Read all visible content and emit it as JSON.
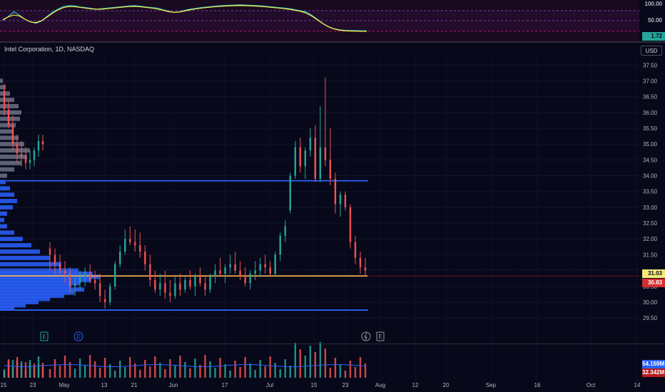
{
  "symbol": "Intel Corporation, 1D, NASDAQ",
  "currency": "USD",
  "stoch": {
    "levels": [
      "100.00",
      "50.00"
    ],
    "value_label": "1.72",
    "k_color": "#26c6da",
    "d_color": "#ffeb3b"
  },
  "price_axis": [
    "37.50",
    "37.00",
    "36.50",
    "36.00",
    "35.50",
    "35.00",
    "34.50",
    "34.00",
    "33.50",
    "33.00",
    "32.50",
    "32.00",
    "31.50",
    "30.50",
    "30.00",
    "29.50"
  ],
  "current_price": "31.03",
  "level_price": "30.83",
  "volume_labels": {
    "a": "54.159M",
    "b": "32.342M"
  },
  "time_axis": [
    "15",
    "23",
    "May",
    "13",
    "21",
    "Jun",
    "17",
    "Jul",
    "15",
    "23",
    "Aug",
    "12",
    "20",
    "Sep",
    "16",
    "Oct",
    "14"
  ],
  "events": {
    "earnings": "E",
    "dividend": "D",
    "split": "E"
  },
  "colors": {
    "up": "#26a69a",
    "down": "#ef5350",
    "bg": "#07081a",
    "hline": "#2962ff",
    "hline_gold": "#ffb74d",
    "profile": "#2962ff"
  },
  "chart_data": {
    "type": "candlestick",
    "x": [
      "Apr 11",
      "Apr 12",
      "Apr 15",
      "Apr 16",
      "Apr 17",
      "Apr 18",
      "Apr 19",
      "Apr 22",
      "Apr 23",
      "Apr 24",
      "Apr 25",
      "Apr 26",
      "Apr 29",
      "Apr 30",
      "May 1",
      "May 2",
      "May 3",
      "May 6",
      "May 7",
      "May 8",
      "May 9",
      "May 10",
      "May 13",
      "May 14",
      "May 15",
      "May 16",
      "May 17",
      "May 20",
      "May 21",
      "May 22",
      "May 23",
      "May 24",
      "May 28",
      "May 29",
      "May 30",
      "May 31",
      "Jun 3",
      "Jun 4",
      "Jun 5",
      "Jun 6",
      "Jun 7",
      "Jun 10",
      "Jun 11",
      "Jun 12",
      "Jun 13",
      "Jun 14",
      "Jun 17",
      "Jun 18",
      "Jun 20",
      "Jun 21",
      "Jun 24",
      "Jun 25",
      "Jun 26",
      "Jun 27",
      "Jun 28",
      "Jul 1",
      "Jul 2",
      "Jul 3",
      "Jul 5",
      "Jul 8",
      "Jul 9",
      "Jul 10",
      "Jul 11",
      "Jul 12",
      "Jul 15",
      "Jul 16",
      "Jul 17",
      "Jul 18",
      "Jul 19",
      "Jul 22",
      "Jul 23",
      "Jul 24",
      "Jul 25",
      "Jul 26"
    ],
    "ohlc": [
      [
        36.7,
        36.9,
        35.9,
        36.1
      ],
      [
        36.1,
        36.4,
        35.5,
        35.6
      ],
      [
        35.6,
        35.9,
        34.8,
        35.0
      ],
      [
        35.0,
        35.3,
        34.4,
        34.7
      ],
      [
        34.7,
        35.1,
        34.3,
        34.6
      ],
      [
        34.6,
        34.9,
        34.2,
        34.4
      ],
      [
        34.4,
        34.8,
        34.2,
        34.5
      ],
      [
        34.5,
        34.9,
        34.3,
        34.8
      ],
      [
        34.8,
        35.3,
        34.6,
        35.1
      ],
      [
        35.1,
        35.3,
        34.8,
        35.0
      ],
      [
        31.7,
        31.9,
        31.0,
        31.5
      ],
      [
        31.5,
        31.7,
        30.9,
        31.2
      ],
      [
        31.2,
        31.5,
        30.8,
        31.0
      ],
      [
        31.0,
        31.3,
        30.6,
        30.9
      ],
      [
        30.9,
        31.1,
        30.3,
        30.5
      ],
      [
        30.5,
        30.9,
        30.2,
        30.6
      ],
      [
        30.6,
        31.0,
        30.4,
        30.8
      ],
      [
        30.8,
        31.1,
        30.5,
        30.9
      ],
      [
        30.9,
        31.2,
        30.6,
        30.7
      ],
      [
        30.7,
        31.0,
        30.4,
        30.6
      ],
      [
        30.6,
        30.9,
        30.0,
        30.2
      ],
      [
        30.1,
        30.4,
        29.8,
        30.0
      ],
      [
        30.0,
        30.6,
        29.9,
        30.5
      ],
      [
        30.5,
        31.3,
        30.4,
        31.2
      ],
      [
        31.2,
        31.8,
        31.1,
        31.6
      ],
      [
        31.6,
        32.3,
        31.5,
        32.0
      ],
      [
        32.0,
        32.4,
        31.8,
        31.9
      ],
      [
        31.9,
        32.3,
        31.6,
        31.8
      ],
      [
        31.8,
        32.2,
        31.4,
        31.6
      ],
      [
        31.6,
        31.8,
        31.0,
        31.2
      ],
      [
        31.2,
        31.5,
        30.5,
        30.7
      ],
      [
        30.7,
        31.0,
        30.3,
        30.4
      ],
      [
        30.4,
        30.9,
        30.2,
        30.6
      ],
      [
        30.6,
        31.0,
        30.1,
        30.3
      ],
      [
        30.3,
        30.7,
        30.0,
        30.2
      ],
      [
        30.2,
        30.8,
        30.1,
        30.6
      ],
      [
        30.6,
        30.9,
        30.2,
        30.4
      ],
      [
        30.4,
        30.8,
        30.3,
        30.7
      ],
      [
        30.7,
        31.0,
        30.4,
        30.5
      ],
      [
        30.5,
        30.9,
        30.2,
        30.8
      ],
      [
        30.8,
        31.1,
        30.5,
        30.6
      ],
      [
        30.6,
        30.8,
        30.2,
        30.4
      ],
      [
        30.4,
        30.9,
        30.3,
        30.8
      ],
      [
        30.8,
        31.2,
        30.6,
        31.0
      ],
      [
        31.0,
        31.4,
        30.8,
        30.9
      ],
      [
        30.9,
        31.2,
        30.6,
        31.1
      ],
      [
        31.1,
        31.5,
        30.9,
        31.2
      ],
      [
        31.2,
        31.6,
        30.9,
        31.0
      ],
      [
        31.0,
        31.3,
        30.7,
        30.8
      ],
      [
        30.8,
        31.1,
        30.5,
        30.6
      ],
      [
        30.6,
        31.0,
        30.4,
        30.9
      ],
      [
        30.9,
        31.3,
        30.7,
        31.0
      ],
      [
        31.0,
        31.4,
        30.8,
        31.2
      ],
      [
        31.2,
        31.5,
        30.9,
        31.1
      ],
      [
        31.1,
        31.3,
        30.8,
        30.9
      ],
      [
        30.9,
        31.6,
        30.8,
        31.5
      ],
      [
        31.5,
        32.2,
        31.3,
        32.1
      ],
      [
        32.1,
        32.6,
        31.9,
        32.4
      ],
      [
        32.9,
        34.1,
        32.8,
        34.0
      ],
      [
        34.0,
        35.1,
        33.9,
        34.9
      ],
      [
        34.9,
        35.2,
        34.1,
        34.3
      ],
      [
        34.3,
        34.9,
        33.9,
        34.8
      ],
      [
        34.8,
        35.5,
        34.6,
        35.2
      ],
      [
        35.2,
        35.6,
        33.8,
        33.9
      ],
      [
        33.9,
        36.2,
        33.8,
        34.9
      ],
      [
        34.9,
        37.1,
        34.3,
        34.5
      ],
      [
        34.5,
        35.5,
        33.7,
        33.9
      ],
      [
        33.9,
        34.1,
        32.8,
        33.1
      ],
      [
        33.1,
        33.5,
        32.7,
        33.4
      ],
      [
        33.4,
        33.5,
        32.9,
        33.0
      ],
      [
        33.0,
        33.1,
        31.7,
        31.9
      ],
      [
        31.9,
        32.1,
        31.2,
        31.4
      ],
      [
        31.4,
        31.6,
        30.9,
        31.1
      ],
      [
        31.1,
        31.4,
        30.8,
        31.0
      ]
    ],
    "horizontal_levels": [
      33.84,
      30.83,
      29.75
    ],
    "ylim": [
      29.3,
      37.8
    ]
  }
}
